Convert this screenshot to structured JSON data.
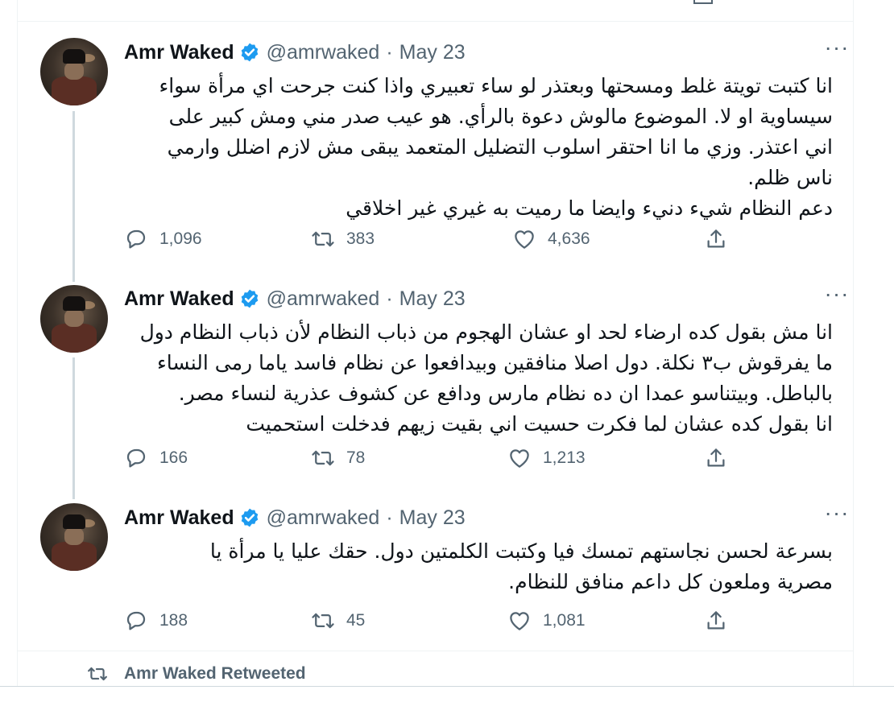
{
  "colors": {
    "verified": "#1d9bf0",
    "secondary_text": "#536471",
    "thread_line": "#cfd9de"
  },
  "icons": {
    "verified": "verified-badge-icon",
    "reply": "reply-icon",
    "retweet": "retweet-icon",
    "like": "heart-icon",
    "share": "share-icon",
    "more": "more-dots-icon"
  },
  "tweets": [
    {
      "author": "Amr Waked",
      "handle": "@amrwaked",
      "separator": "·",
      "date": "May 23",
      "more": "···",
      "text": "انا كتبت تويتة غلط ومسحتها وبعتذر لو ساء تعبيري واذا كنت جرحت اي مرأة سواء\nسيساوية او لا. الموضوع مالوش دعوة بالرأي. هو عيب صدر مني ومش كبير على\nاني اعتذر. وزي ما انا احتقر اسلوب التضليل المتعمد يبقى مش لازم اضلل وارمي\nناس ظلم.\nدعم النظام شيء دنيء وايضا ما رميت به غيري غير اخلاقي",
      "replies": "1,096",
      "retweets": "383",
      "likes": "4,636"
    },
    {
      "author": "Amr Waked",
      "handle": "@amrwaked",
      "separator": "·",
      "date": "May 23",
      "more": "···",
      "text": "انا مش بقول كده ارضاء لحد او عشان الهجوم من ذباب النظام لأن ذباب النظام دول\nما يفرقوش ب٣ نكلة. دول اصلا منافقين وبيدافعوا عن نظام فاسد ياما رمى النساء\nبالباطل. وبيتناسو عمدا ان ده نظام مارس ودافع عن كشوف عذرية لنساء مصر.\nانا بقول كده عشان لما فكرت حسيت اني بقيت زيهم فدخلت استحميت",
      "replies": "166",
      "retweets": "78",
      "likes": "1,213"
    },
    {
      "author": "Amr Waked",
      "handle": "@amrwaked",
      "separator": "·",
      "date": "May 23",
      "more": "···",
      "text": "بسرعة لحسن نجاستهم تمسك فيا وكتبت الكلمتين دول. حقك عليا يا مرأة يا\nمصرية وملعون كل داعم منافق للنظام.",
      "replies": "188",
      "retweets": "45",
      "likes": "1,081"
    }
  ],
  "retweeted_label": "Amr Waked Retweeted"
}
